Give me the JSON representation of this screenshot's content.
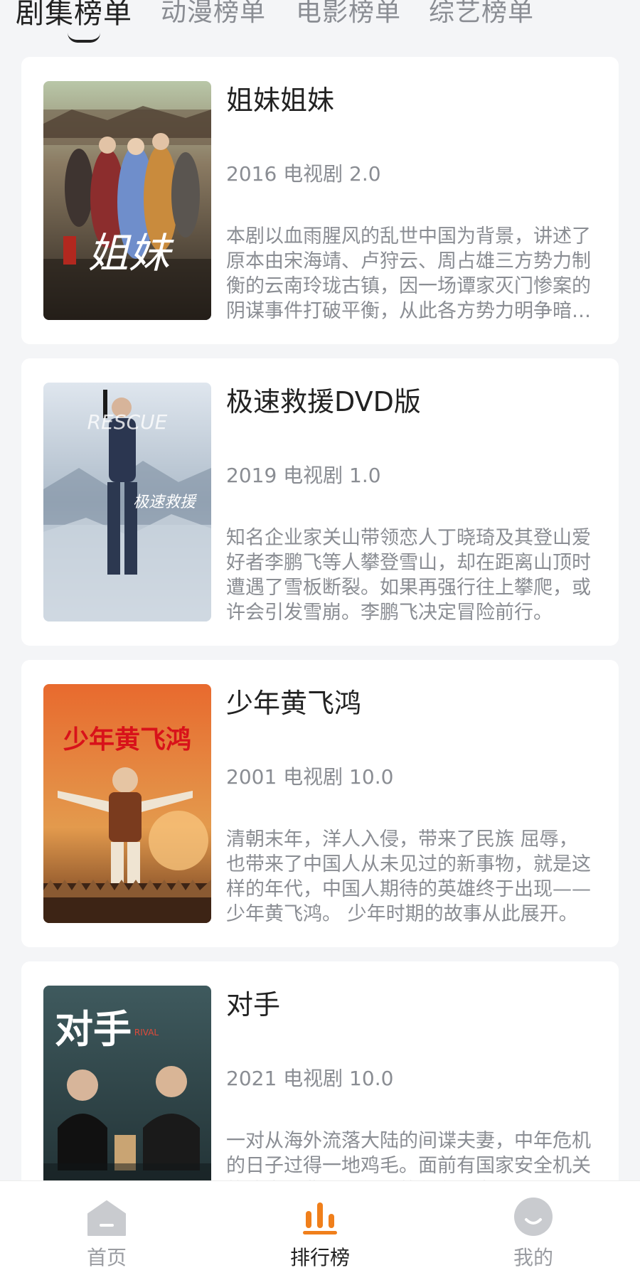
{
  "tabs": [
    {
      "label": "剧集榜单",
      "active": true
    },
    {
      "label": "动漫榜单",
      "active": false
    },
    {
      "label": "电影榜单",
      "active": false
    },
    {
      "label": "综艺榜单",
      "active": false
    }
  ],
  "items": [
    {
      "title": "姐妹姐妹",
      "meta": "2016 电视剧 2.0",
      "description": "本剧以血雨腥风的乱世中国为背景，讲述了原本由宋海靖、卢狩云、周占雄三方势力制衡的云南玲珑古镇，因一场谭家灭门惨案的阴谋事件打破平衡，从此各方势力明争暗斗。",
      "poster_text": "姐妹",
      "poster_badge": "姐妹"
    },
    {
      "title": "极速救援DVD版",
      "meta": "2019 电视剧 1.0",
      "description": "知名企业家关山带领恋人丁晓琦及其登山爱好者李鹏飞等人攀登雪山，却在距离山顶时遭遇了雪板断裂。如果再强行往上攀爬，或许会引发雪崩。李鹏飞决定冒险前行。",
      "poster_text": "极速救援",
      "poster_subtext": "RESCUE"
    },
    {
      "title": "少年黄飞鸿",
      "meta": "2001 电视剧 10.0",
      "description": "清朝末年，洋人入侵，带来了民族 屈辱，也带来了中国人从未见过的新事物，就是这样的年代，中国人期待的英雄终于出现——少年黄飞鸿。 少年时期的故事从此展开。",
      "poster_text": "少年黄飞鸿"
    },
    {
      "title": "对手",
      "meta": "2021 电视剧 10.0",
      "description": "一对从海外流落大陆的间谍夫妻，中年危机的日子过得一地鸡毛。面前有国家安全机关的追查，背后有组织的任务压力。",
      "poster_text": "对手",
      "poster_subtext": "RIVAL"
    }
  ],
  "nav": [
    {
      "label": "首页",
      "icon": "home-icon",
      "active": false
    },
    {
      "label": "排行榜",
      "icon": "ranking-icon",
      "active": true
    },
    {
      "label": "我的",
      "icon": "profile-icon",
      "active": false
    }
  ],
  "colors": {
    "accent": "#f07f1b",
    "inactive": "#c9cbcf"
  }
}
